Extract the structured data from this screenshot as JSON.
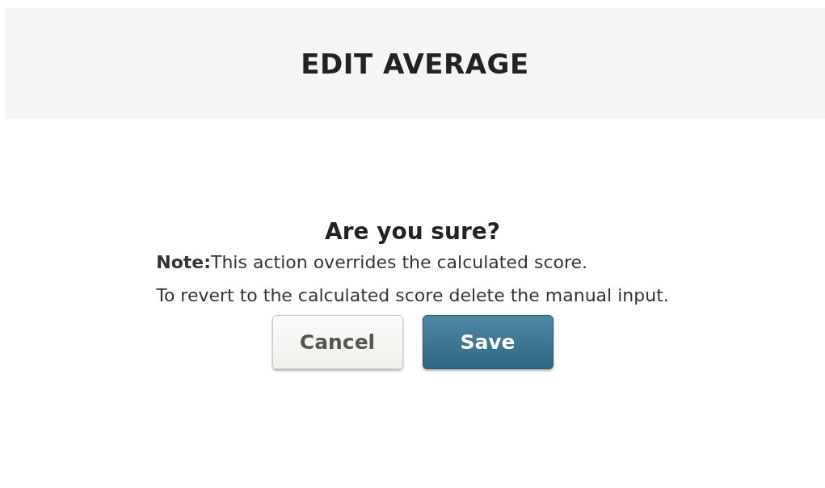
{
  "dialog": {
    "title": "EDIT AVERAGE",
    "heading": "Are you sure?",
    "lines": [
      "**Note:**This action overrides the calculated score.",
      "To revert to the calculated score delete the manual input."
    ],
    "buttons": [
      {
        "label": "Cancel",
        "kind": "secondary"
      },
      {
        "label": "Save",
        "kind": "primary"
      }
    ]
  }
}
